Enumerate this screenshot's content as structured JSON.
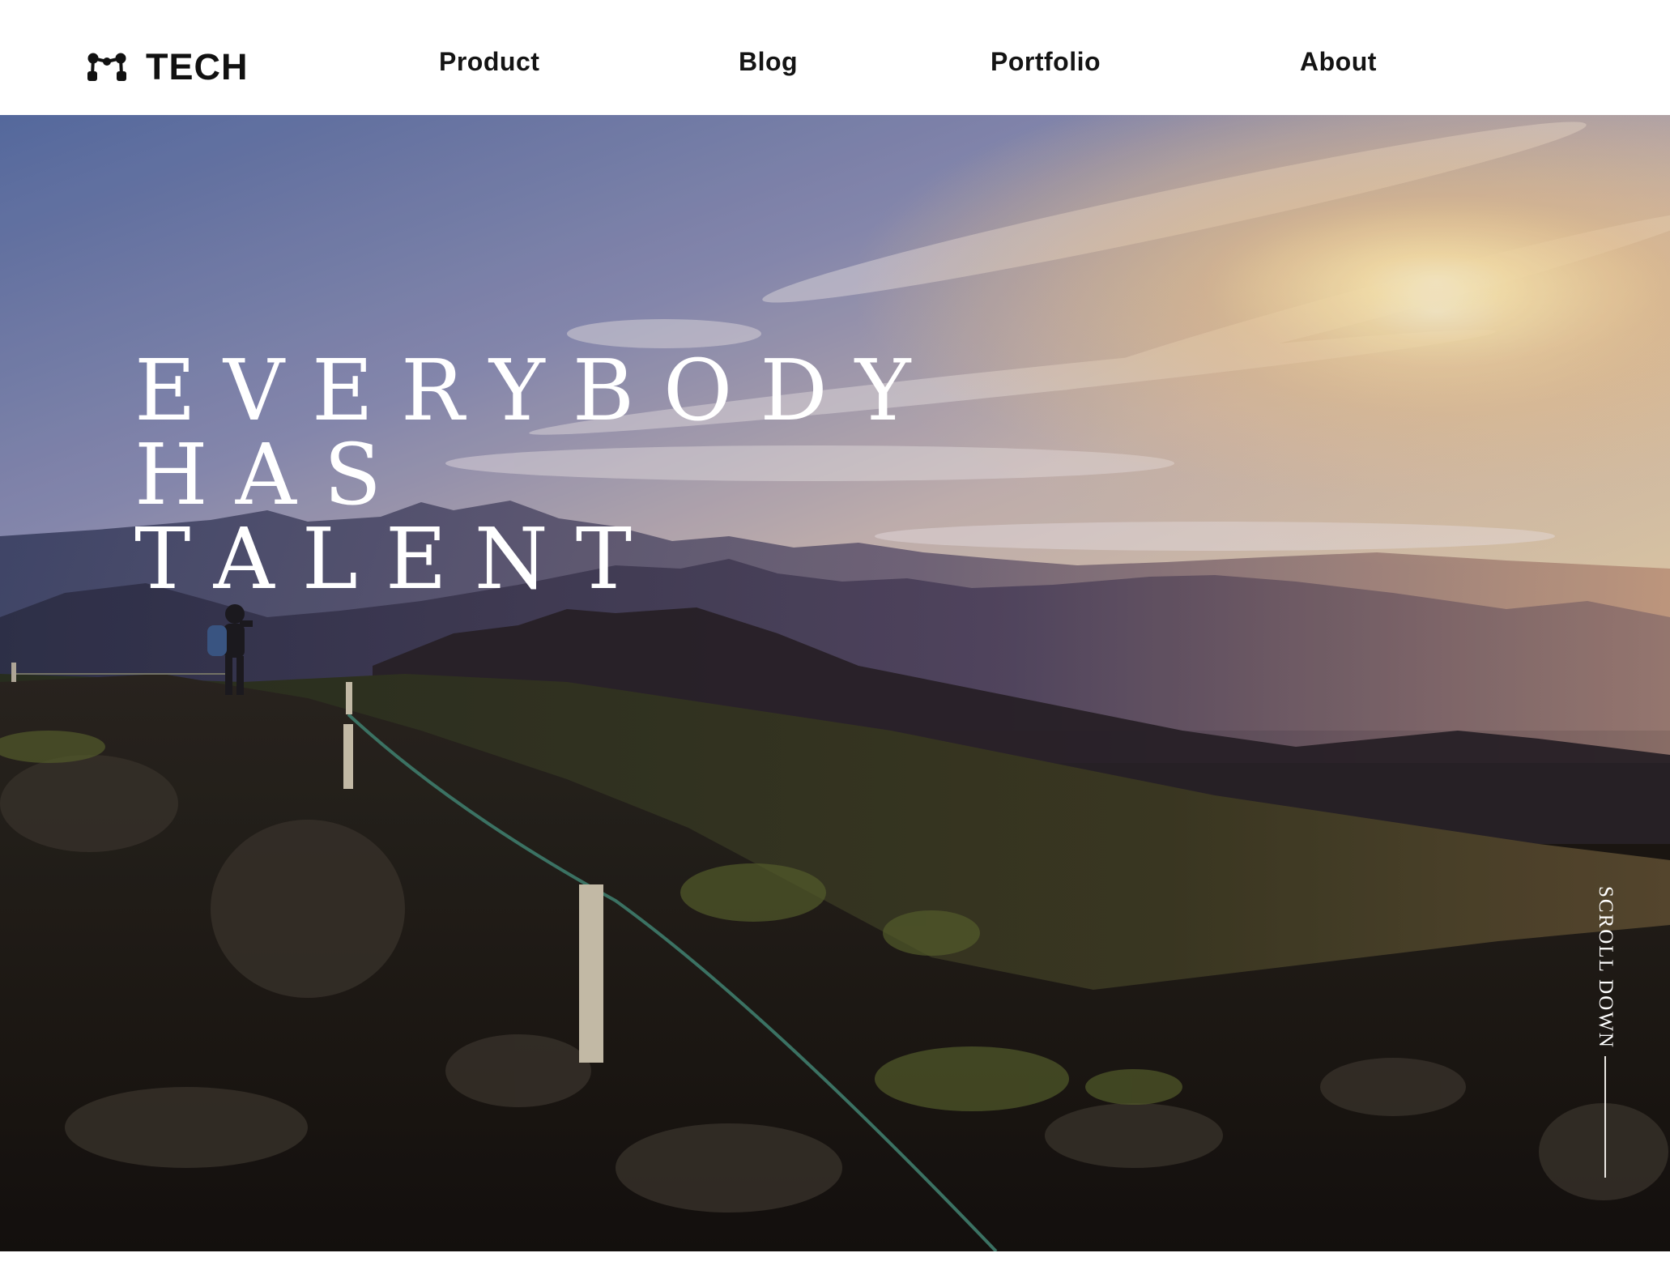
{
  "brand": {
    "name": "TECH",
    "logo_icon": "molecule-logo-icon"
  },
  "nav": {
    "items": [
      {
        "label": "Product"
      },
      {
        "label": "Blog"
      },
      {
        "label": "Portfolio"
      },
      {
        "label": "About"
      }
    ]
  },
  "hero": {
    "headline_lines": [
      "EVERYBODY",
      "HAS",
      "TALENT"
    ],
    "background": "mountain-sunrise-photo",
    "scroll_label": "SCROLL DOWN"
  },
  "colors": {
    "header_bg": "#ffffff",
    "nav_text": "#141414",
    "hero_text": "#ffffff"
  }
}
